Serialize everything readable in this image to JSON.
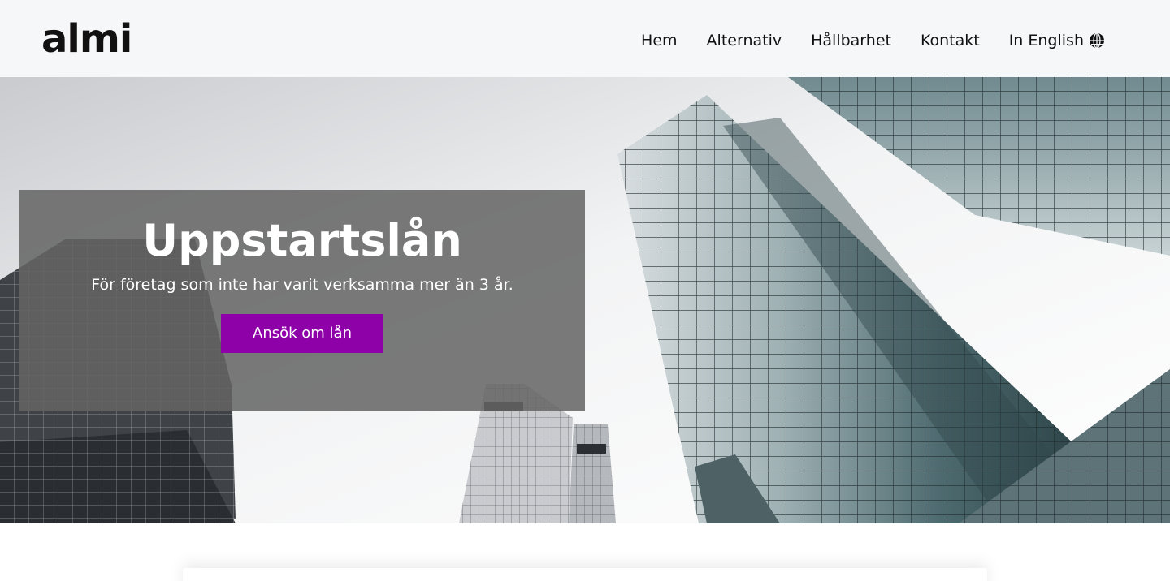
{
  "brand": {
    "logo_text": "almi"
  },
  "nav": {
    "items": [
      {
        "label": "Hem"
      },
      {
        "label": "Alternativ"
      },
      {
        "label": "Hållbarhet"
      },
      {
        "label": "Kontakt"
      },
      {
        "label": "In English",
        "icon": "globe-icon"
      }
    ]
  },
  "hero": {
    "title": "Uppstartslån",
    "subtitle": "För företag som inte har varit verksamma mer än 3 år.",
    "cta_label": "Ansök om lån",
    "image": "skyscrapers-photo"
  },
  "colors": {
    "accent": "#8e00a8",
    "header_bg": "#f6f7f9",
    "overlay": "#646464"
  }
}
